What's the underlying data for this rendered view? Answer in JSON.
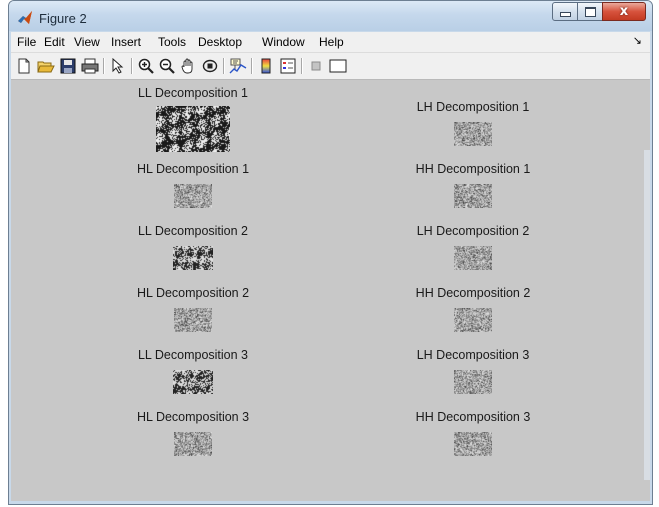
{
  "window": {
    "title": "Figure 2",
    "controls": {
      "minimize": "minimize",
      "maximize": "maximize",
      "close": "x"
    }
  },
  "menubar": {
    "items": [
      "File",
      "Edit",
      "View",
      "Insert",
      "Tools",
      "Desktop",
      "Window",
      "Help"
    ],
    "dock_arrow": "↘"
  },
  "toolbar": {
    "buttons": [
      {
        "name": "new-figure",
        "icon": "new-file-icon"
      },
      {
        "name": "open-file",
        "icon": "open-folder-icon"
      },
      {
        "name": "save-figure",
        "icon": "save-disk-icon"
      },
      {
        "name": "print-figure",
        "icon": "printer-icon"
      },
      {
        "name": "edit-plot",
        "icon": "arrow-pointer-icon"
      },
      {
        "name": "zoom-in",
        "icon": "zoom-in-icon"
      },
      {
        "name": "zoom-out",
        "icon": "zoom-out-icon"
      },
      {
        "name": "pan",
        "icon": "hand-pan-icon"
      },
      {
        "name": "rotate-3d",
        "icon": "rotate-3d-icon"
      },
      {
        "name": "data-cursor",
        "icon": "data-cursor-icon"
      },
      {
        "name": "insert-colorbar",
        "icon": "colorbar-icon"
      },
      {
        "name": "insert-legend",
        "icon": "legend-icon"
      },
      {
        "name": "hide-plot-tools",
        "icon": "hide-tools-icon"
      },
      {
        "name": "show-plot-tools",
        "icon": "show-tools-icon"
      }
    ]
  },
  "subplots": [
    {
      "title": "LL Decomposition 1",
      "kind": "approx-large"
    },
    {
      "title": "LH Decomposition 1",
      "kind": "detail"
    },
    {
      "title": "HL Decomposition 1",
      "kind": "detail"
    },
    {
      "title": "HH Decomposition 1",
      "kind": "detail"
    },
    {
      "title": "LL Decomposition 2",
      "kind": "approx-small"
    },
    {
      "title": "LH Decomposition 2",
      "kind": "detail"
    },
    {
      "title": "HL Decomposition 2",
      "kind": "detail"
    },
    {
      "title": "HH Decomposition 2",
      "kind": "detail"
    },
    {
      "title": "LL Decomposition 3",
      "kind": "approx-small"
    },
    {
      "title": "LH Decomposition 3",
      "kind": "detail"
    },
    {
      "title": "HL Decomposition 3",
      "kind": "detail"
    },
    {
      "title": "HH Decomposition 3",
      "kind": "detail"
    }
  ]
}
